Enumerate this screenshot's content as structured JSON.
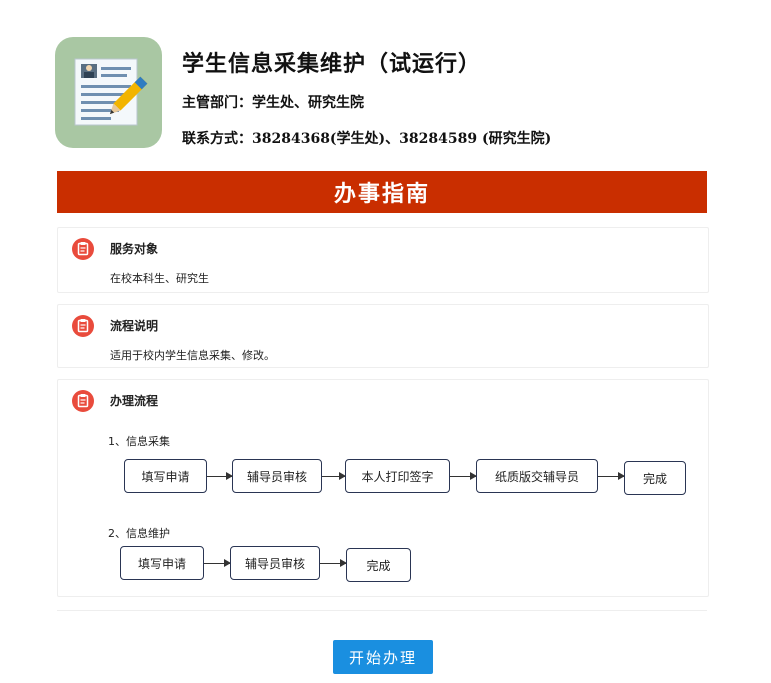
{
  "header": {
    "title": "学生信息采集维护（试运行）",
    "department": "主管部门：学生处、研究生院",
    "contact": "联系方式：38284368(学生处)、38284589 (研究生院)"
  },
  "banner": {
    "title": "办事指南"
  },
  "sections": {
    "service_target": {
      "title": "服务对象",
      "body": "在校本科生、研究生"
    },
    "process_desc": {
      "title": "流程说明",
      "body": "适用于校内学生信息采集、修改。"
    },
    "process_flow": {
      "title": "办理流程"
    }
  },
  "flows": {
    "collect": {
      "label": "1、信息采集",
      "steps": [
        "填写申请",
        "辅导员审核",
        "本人打印签字",
        "纸质版交辅导员",
        "完成"
      ]
    },
    "maintain": {
      "label": "2、信息维护",
      "steps": [
        "填写申请",
        "辅导员审核",
        "完成"
      ]
    }
  },
  "actions": {
    "start_label": "开始办理"
  },
  "colors": {
    "banner": "#c92e00",
    "section_icon": "#e94b3c",
    "button": "#1a8fe0",
    "flow_border": "#2a3553"
  }
}
